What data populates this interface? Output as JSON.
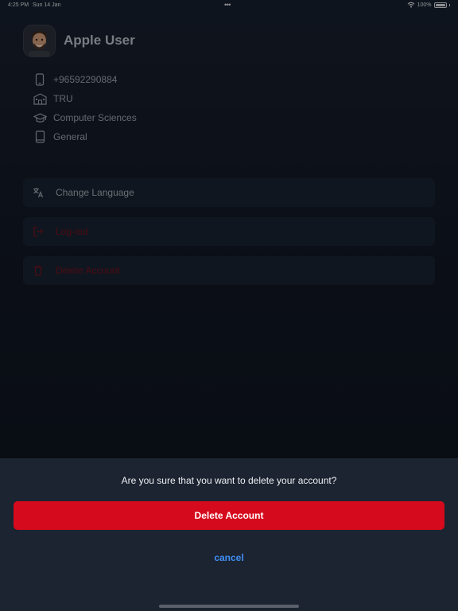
{
  "status_bar": {
    "time": "4:25 PM",
    "date": "Sun 14 Jan",
    "dots": "•••",
    "battery": "100%"
  },
  "profile": {
    "name": "Apple User",
    "phone": "+96592290884",
    "university": "TRU",
    "major": "Computer Sciences",
    "level": "General"
  },
  "menu": {
    "change_language": "Change Language",
    "logout": "Log-out",
    "delete_account": "Delete Account"
  },
  "dialog": {
    "question": "Are you sure that you want to delete your account?",
    "confirm_label": "Delete Account",
    "cancel_label": "cancel"
  },
  "colors": {
    "background": "#141a24",
    "card": "#1a2433",
    "danger": "#d50a1c",
    "link": "#3f8ff5"
  },
  "icons": {
    "phone": "smartphone-icon",
    "university": "building-icon",
    "major": "graduation-cap-icon",
    "level": "book-icon",
    "language": "translate-icon",
    "logout": "logout-icon",
    "delete": "trash-icon"
  }
}
